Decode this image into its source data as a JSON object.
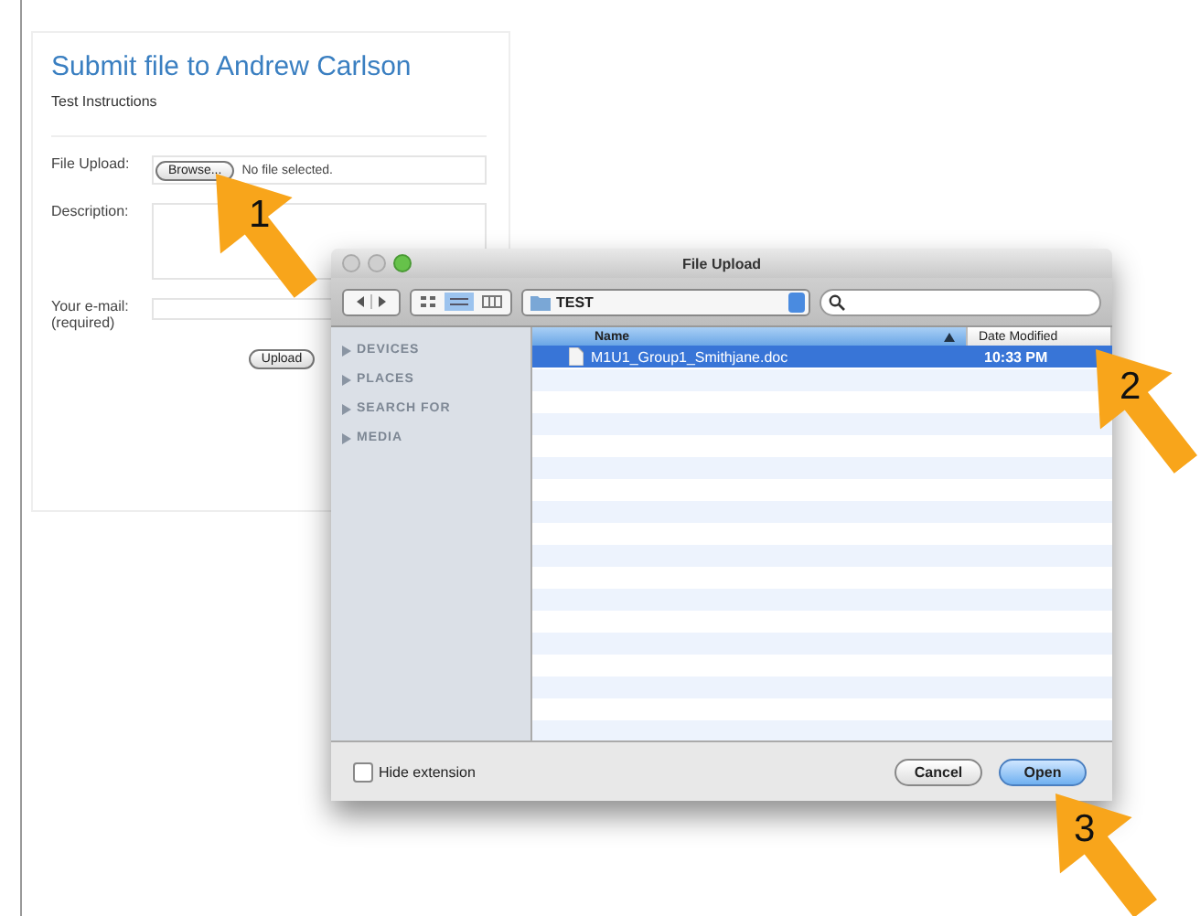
{
  "form": {
    "title": "Submit file to Andrew Carlson",
    "instructions": "Test Instructions",
    "fields": [
      {
        "kind": "file",
        "label": "File Upload:",
        "button": "Browse...",
        "value": "No file selected."
      },
      {
        "kind": "textarea",
        "label": "Description:"
      },
      {
        "kind": "text",
        "label": "Your e-mail:",
        "note": "(required)"
      }
    ],
    "submit": "Upload"
  },
  "dialog": {
    "title": "File Upload",
    "location": "TEST",
    "sidebar": [
      "DEVICES",
      "PLACES",
      "SEARCH FOR",
      "MEDIA"
    ],
    "columns": [
      {
        "label": "Name",
        "sorted": true
      },
      {
        "label": "Date Modified",
        "sorted": false
      }
    ],
    "rows": [
      {
        "name": "M1U1_Group1_Smithjane.doc",
        "date": "10:33 PM",
        "selected": true
      }
    ],
    "hide_extension": {
      "label": "Hide extension",
      "checked": false
    },
    "buttons": [
      {
        "label": "Cancel",
        "default": false
      },
      {
        "label": "Open",
        "default": true
      }
    ]
  },
  "callouts": [
    "1",
    "2",
    "3"
  ]
}
